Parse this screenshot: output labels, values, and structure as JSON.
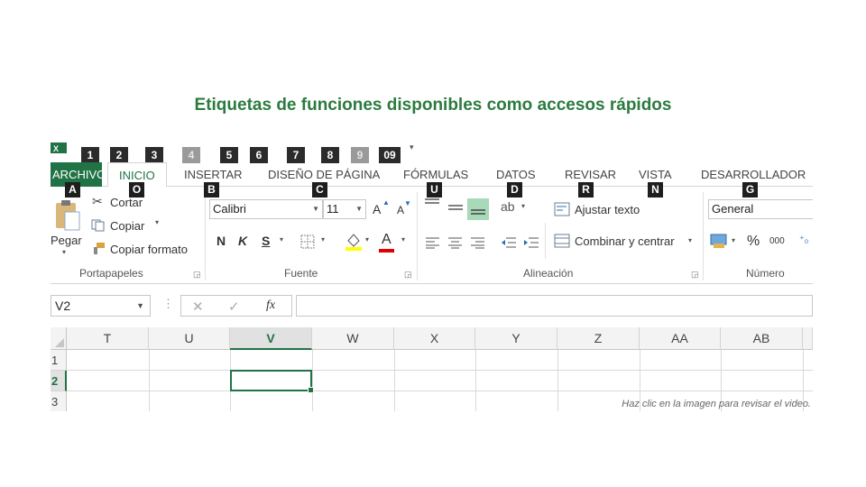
{
  "heading": "Etiquetas de funciones disponibles como accesos rápidos",
  "caption": "Haz clic en la imagen para revisar el video.",
  "qat_tags": [
    "1",
    "2",
    "3",
    "4",
    "5",
    "6",
    "7",
    "8",
    "9",
    "09"
  ],
  "tabs": {
    "archivo": "ARCHIVO",
    "inicio": "INICIO",
    "insertar": "INSERTAR",
    "diseno": "DISEÑO DE PÁGINA",
    "formulas": "FÓRMULAS",
    "datos": "DATOS",
    "revisar": "REVISAR",
    "vista": "VISTA",
    "desarrollador": "DESARROLLADOR"
  },
  "key_tags": {
    "archivo": "A",
    "inicio": "O",
    "insertar": "B",
    "diseno": "C",
    "formulas": "U",
    "datos": "D",
    "revisar": "R",
    "vista": "N",
    "desarrollador": "G"
  },
  "clipboard": {
    "paste": "Pegar",
    "cut": "Cortar",
    "copy": "Copiar",
    "format_painter": "Copiar formato",
    "group_label": "Portapapeles"
  },
  "font": {
    "name": "Calibri",
    "size": "11",
    "grow": "A",
    "shrink": "A",
    "bold": "N",
    "italic": "K",
    "underline": "S",
    "color_letter": "A",
    "group_label": "Fuente"
  },
  "alignment": {
    "wrap": "Ajustar texto",
    "merge": "Combinar y centrar",
    "group_label": "Alineación"
  },
  "number": {
    "format": "General",
    "percent": "%",
    "thousands": "000",
    "group_label": "Número"
  },
  "formula_bar": {
    "name_box": "V2",
    "fx": "fx"
  },
  "columns": [
    "T",
    "U",
    "V",
    "W",
    "X",
    "Y",
    "Z",
    "AA",
    "AB"
  ],
  "selected_column": "V",
  "rows": [
    "1",
    "2",
    "3"
  ],
  "selected_row": "2",
  "colors": {
    "accent": "#217346",
    "heading": "#2b7b3f"
  }
}
